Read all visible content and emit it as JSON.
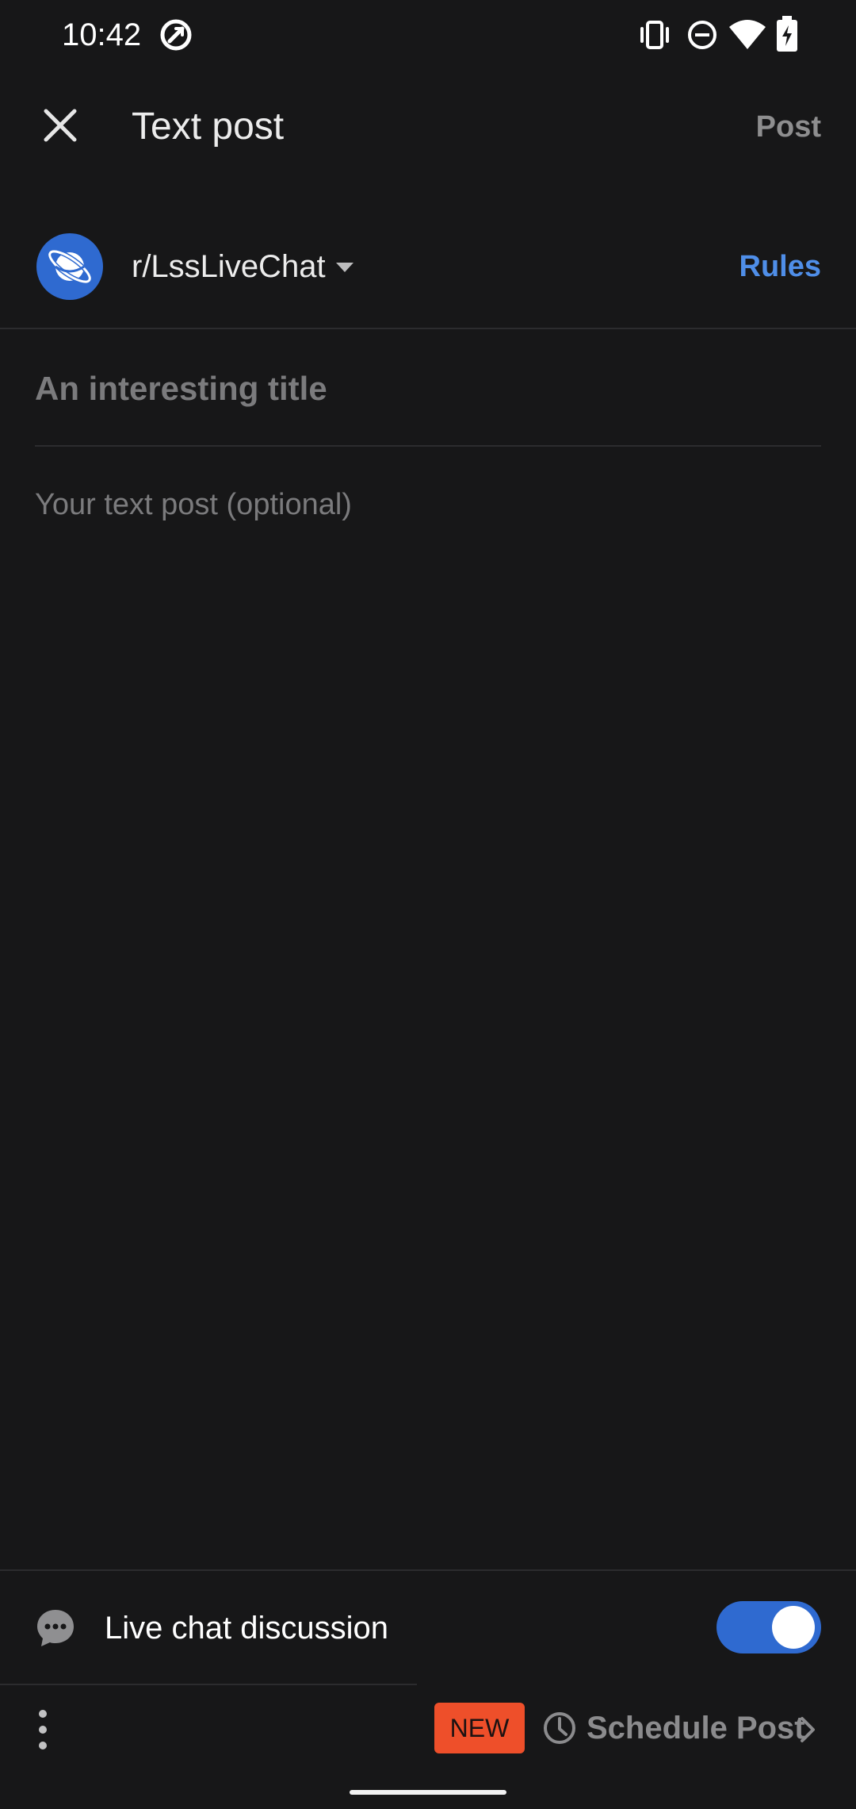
{
  "status_bar": {
    "time": "10:42",
    "icons": [
      "data-saver-icon",
      "vibrate-icon",
      "do-not-disturb-icon",
      "wifi-icon",
      "battery-charging-icon"
    ]
  },
  "header": {
    "close_icon": "close-icon",
    "title": "Text post",
    "post_label": "Post"
  },
  "community": {
    "name": "r/LssLiveChat",
    "avatar_icon": "planet-icon",
    "dropdown_icon": "caret-down-icon",
    "rules_label": "Rules"
  },
  "form": {
    "title_placeholder": "An interesting title",
    "title_value": "",
    "body_placeholder": "Your text post (optional)",
    "body_value": ""
  },
  "live_chat": {
    "icon": "chat-bubble-icon",
    "label": "Live chat discussion",
    "enabled": true
  },
  "bottom_bar": {
    "more_icon": "more-vertical-icon",
    "badge": "NEW",
    "schedule_icon": "clock-icon",
    "schedule_label": "Schedule Post",
    "chevron_icon": "chevron-right-icon"
  },
  "colors": {
    "background": "#171718",
    "accent": "#2f6ad0",
    "link": "#4f8ee8",
    "badge": "#ee4f2a",
    "muted": "#8e8e8f"
  }
}
